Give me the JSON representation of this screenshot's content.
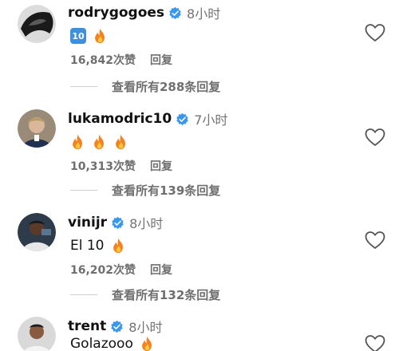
{
  "comments": [
    {
      "username": "rodrygogoes",
      "time": "8小时",
      "badge": "10",
      "text": "",
      "fires": 1,
      "likes": "16,842次赞",
      "reply": "回复",
      "view_replies": "查看所有288条回复",
      "avatar": "rodrygo-avatar"
    },
    {
      "username": "lukamodric10",
      "time": "7小时",
      "badge": "",
      "text": "",
      "fires": 3,
      "likes": "10,313次赞",
      "reply": "回复",
      "view_replies": "查看所有139条回复",
      "avatar": "modric-avatar"
    },
    {
      "username": "vinijr",
      "time": "8小时",
      "badge": "",
      "text": "El 10",
      "fires": 1,
      "likes": "16,202次赞",
      "reply": "回复",
      "view_replies": "查看所有132条回复",
      "avatar": "vinijr-avatar"
    },
    {
      "username": "trent",
      "time": "8小时",
      "badge": "",
      "text": "Golazooo",
      "fires": 1,
      "likes": "",
      "reply": "",
      "view_replies": "",
      "avatar": "trent-avatar"
    }
  ],
  "colors": {
    "verified": "#3897f0",
    "secondary_text": "#737373",
    "fire": "#f5821f"
  },
  "icons": [
    "verified-icon",
    "fire-icon",
    "heart-icon",
    "keycap-ten-icon"
  ]
}
